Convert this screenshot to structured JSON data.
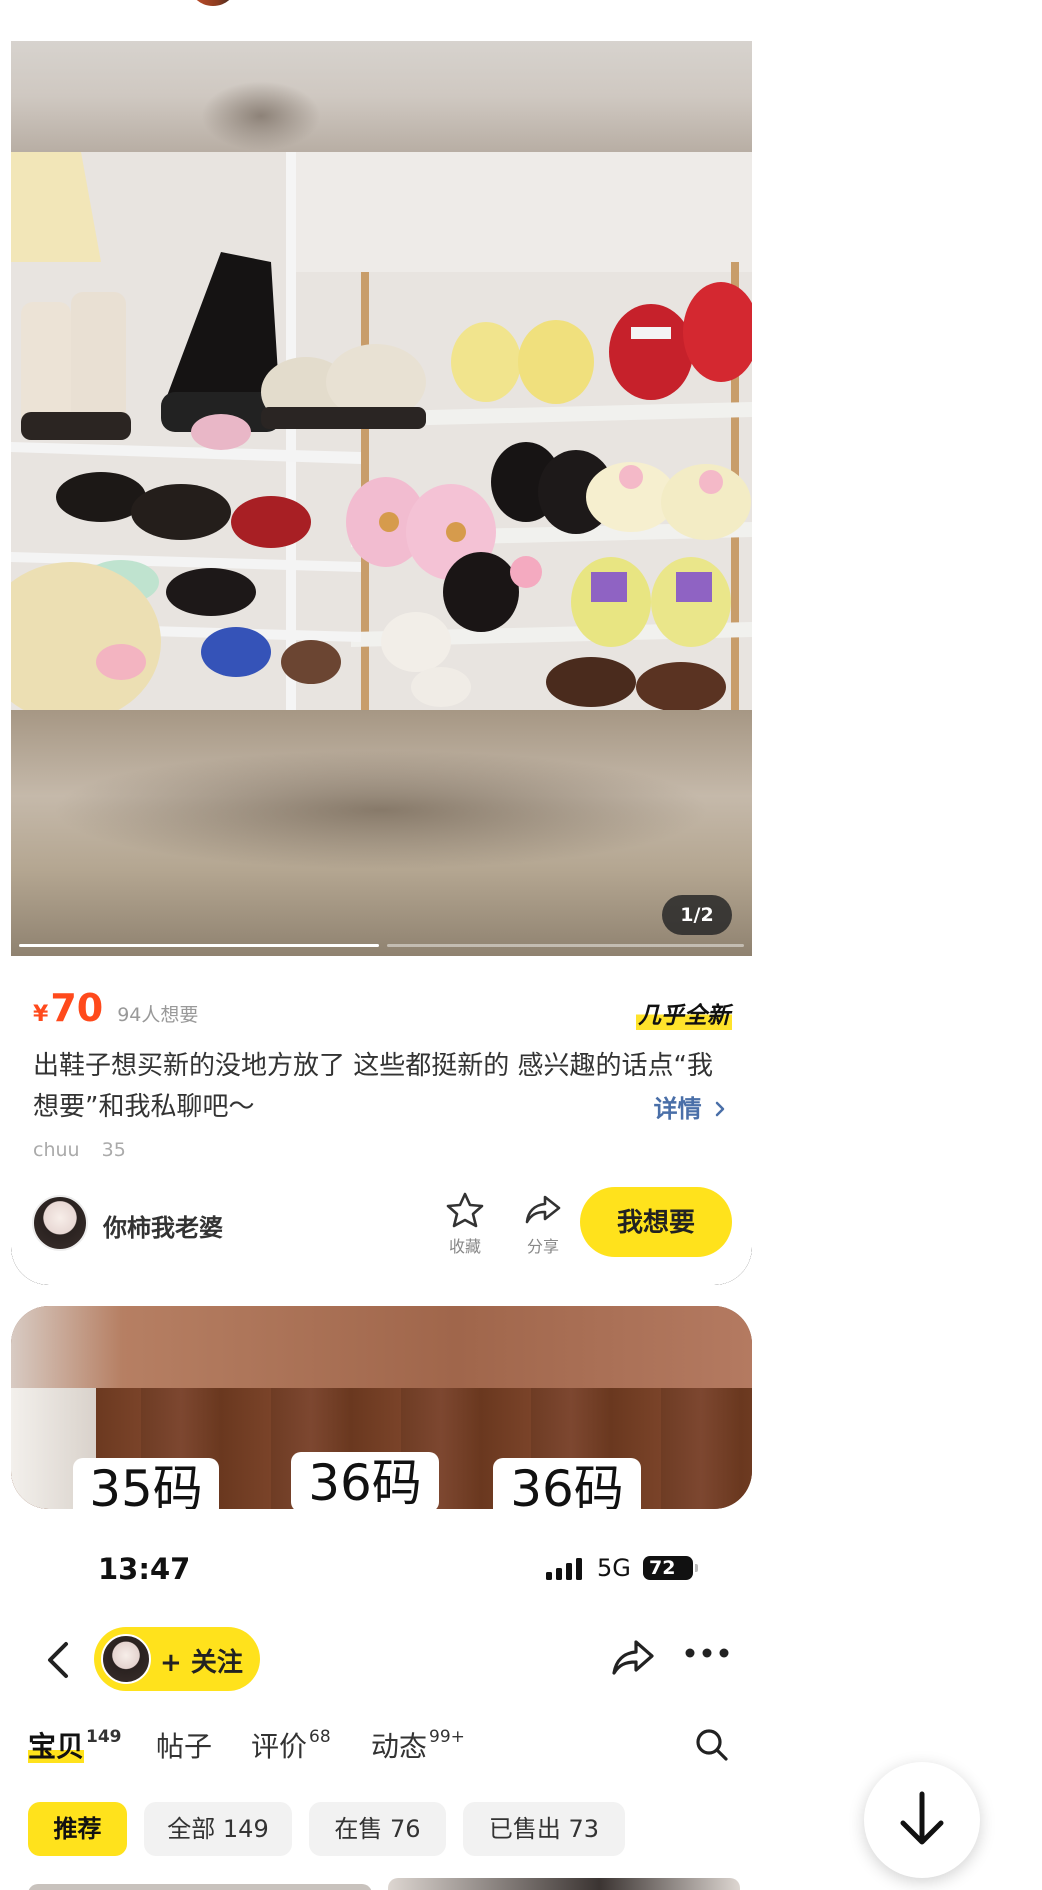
{
  "product": {
    "image_counter": "1/2",
    "price_symbol": "¥",
    "price": "70",
    "want_count": "94人想要",
    "condition": "几乎全新",
    "description": "出鞋子想买新的没地方放了 这些都挺新的  感兴趣的话点“我想要”和我私聊吧～",
    "detail_link": "详情",
    "meta_brand": "chuu",
    "meta_size": "35",
    "seller_name": "你柿我老婆",
    "favorite_label": "收藏",
    "share_label": "分享",
    "want_button": "我想要"
  },
  "next_card": {
    "size_tags": [
      "35码",
      "36码",
      "36码"
    ]
  },
  "status_bar": {
    "time": "13:47",
    "network": "5G",
    "battery": "72"
  },
  "shop_nav": {
    "follow_label": "+ 关注"
  },
  "tabs": [
    {
      "label": "宝贝",
      "count": "149",
      "active": true
    },
    {
      "label": "帖子",
      "count": ""
    },
    {
      "label": "评价",
      "count": "68"
    },
    {
      "label": "动态",
      "count": "99+"
    }
  ],
  "filters": [
    {
      "label": "推荐",
      "active": true
    },
    {
      "label": "全部 149"
    },
    {
      "label": "在售 76"
    },
    {
      "label": "已售出 73"
    }
  ],
  "icons": [
    "back-icon",
    "share-icon",
    "more-icon",
    "search-icon",
    "star-icon",
    "arrow-down-icon",
    "chevron-right-icon",
    "signal-icon"
  ],
  "colors": {
    "accent_yellow": "#ffe21c",
    "price_red": "#ff4a1c",
    "link_blue": "#4a6fa8"
  }
}
